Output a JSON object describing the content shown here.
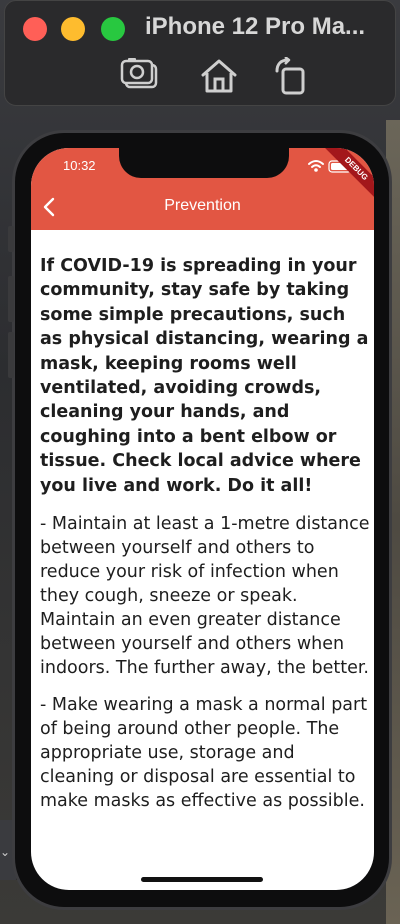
{
  "simulator": {
    "window_title": "iPhone 12 Pro Ma...",
    "toolbar_icons": [
      "screenshot-icon",
      "home-icon",
      "rotate-icon"
    ]
  },
  "status_bar": {
    "time": "10:32",
    "icons": [
      "wifi-icon",
      "battery-icon"
    ],
    "debug_banner": "DEBUG"
  },
  "app_bar": {
    "title": "Prevention",
    "back_icon": "chevron-left-icon",
    "color": "#e25643"
  },
  "content": {
    "intro": "If COVID-19 is spreading in your community, stay safe by taking some simple precautions, such as physical distancing, wearing a mask, keeping rooms well ventilated, avoiding crowds, cleaning your hands, and coughing into a bent elbow or tissue. Check local advice where you live and work. Do it all!",
    "paragraphs": [
      "- Maintain at least a 1-metre distance between yourself and others to reduce your risk of infection when they cough, sneeze or speak. Maintain an even greater distance between yourself and others when indoors. The further away, the better.",
      "- Make wearing a mask a normal part of being around other people. The appropriate use, storage and cleaning or disposal are essential to make masks as effective as possible."
    ]
  }
}
